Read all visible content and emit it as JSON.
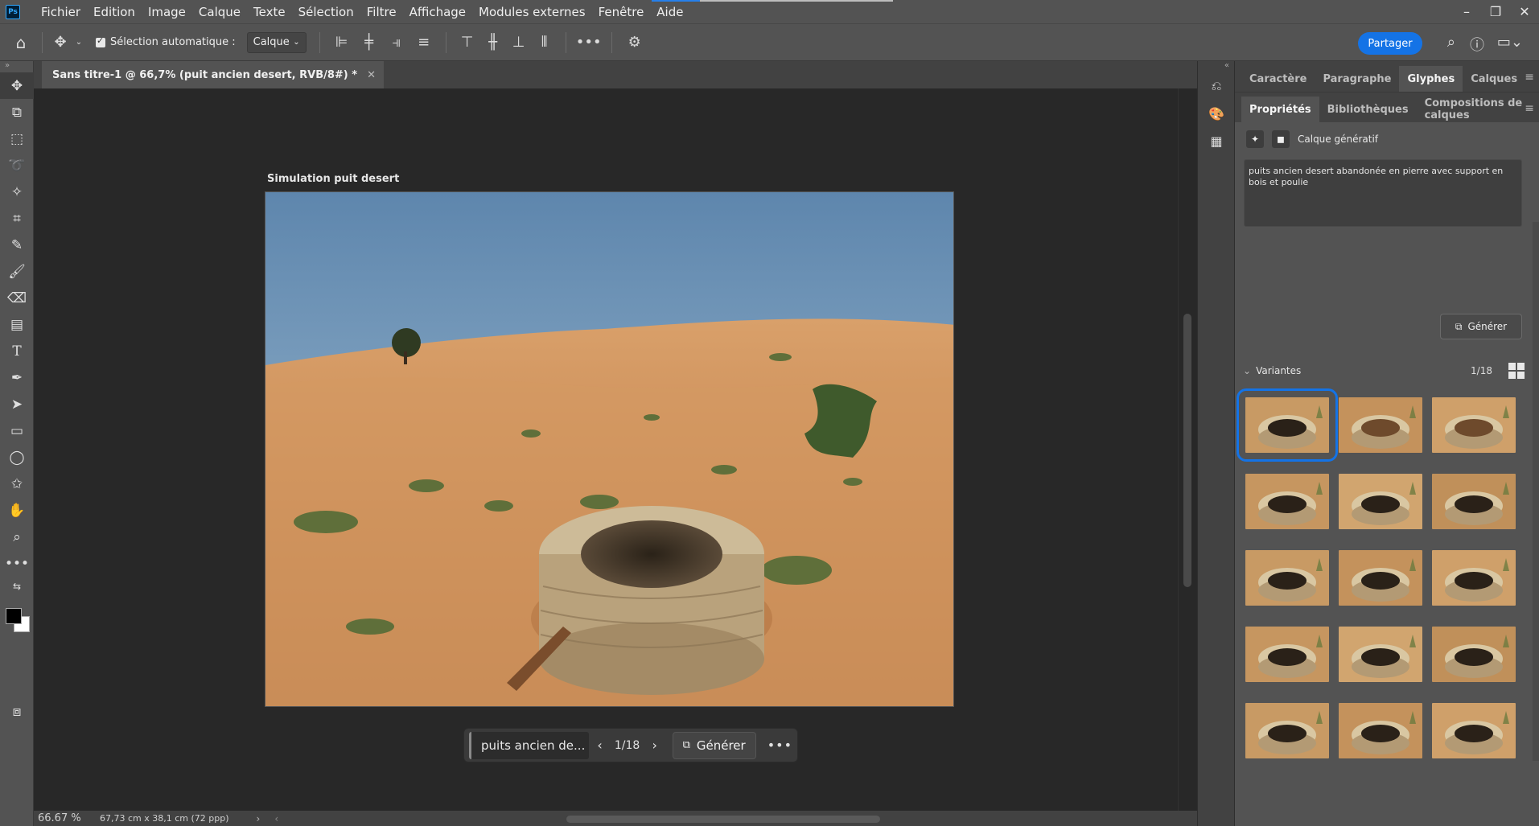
{
  "app": {
    "logo": "Ps",
    "menu": [
      "Fichier",
      "Edition",
      "Image",
      "Calque",
      "Texte",
      "Sélection",
      "Filtre",
      "Affichage",
      "Modules externes",
      "Fenêtre",
      "Aide"
    ],
    "window_controls": [
      "minimize-icon",
      "restore-icon",
      "close-icon"
    ]
  },
  "options_bar": {
    "auto_select_label": "Sélection automatique :",
    "auto_select_checked": true,
    "target_value": "Calque",
    "share_label": "Partager"
  },
  "document": {
    "tab_title": "Sans titre-1 @ 66,7% (puit ancien desert, RVB/8#) *",
    "artboard_name": "Simulation puit desert"
  },
  "context_bar": {
    "prompt_preview": "puits ancien de...",
    "counter": "1/18",
    "generate_label": "Générer"
  },
  "status": {
    "zoom": "66.67 %",
    "doc_size": "67,73 cm x 38,1 cm (72 ppp)"
  },
  "panel": {
    "tabs_top": [
      "Caractère",
      "Paragraphe",
      "Glyphes",
      "Calques"
    ],
    "active_top": "Glyphes",
    "tabs_bottom": [
      "Propriétés",
      "Bibliothèques",
      "Compositions de calques"
    ],
    "active_bottom": "Propriétés",
    "layer_type": "Calque génératif",
    "prompt": "puits ancien desert abandonée en pierre avec support en bois et poulie",
    "generate_label": "Générer",
    "variants_label": "Variantes",
    "variants_count": "1/18",
    "selected_variant": 1,
    "variant_count_visible": 15
  },
  "colors": {
    "accent": "#1473e6",
    "foreground_swatch": "#000000",
    "background_swatch": "#ffffff"
  }
}
